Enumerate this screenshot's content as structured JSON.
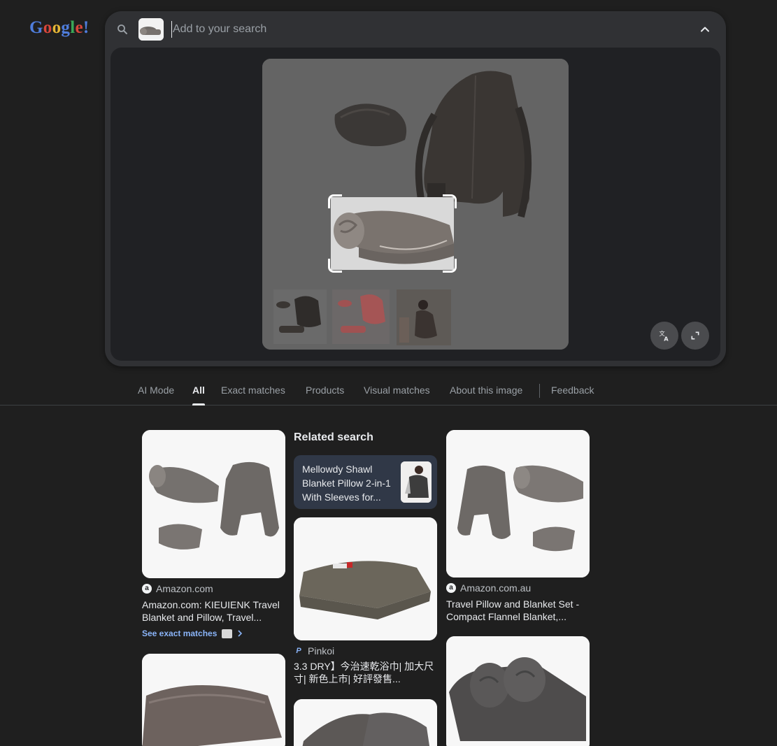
{
  "logo": {
    "letters": [
      "G",
      "o",
      "o",
      "g",
      "l",
      "e",
      "!"
    ]
  },
  "search": {
    "placeholder": "Add to your search"
  },
  "tabs": [
    {
      "label": "AI Mode"
    },
    {
      "label": "All"
    },
    {
      "label": "Exact matches"
    },
    {
      "label": "Products"
    },
    {
      "label": "Visual matches"
    },
    {
      "label": "About this image"
    },
    {
      "label": "Feedback"
    }
  ],
  "results": {
    "related_heading": "Related search",
    "related": {
      "text": "Mellowdy Shawl Blanket Pillow 2-in-1 With Sleeves for..."
    },
    "items": [
      {
        "source": "Amazon.com",
        "title": "Amazon.com: KIEUIENK Travel Blanket and Pillow, Travel...",
        "favicon": "a"
      },
      {
        "source": "Pinkoi",
        "title": "3.3 DRY】今治速乾浴巾| 加大尺寸| 新色上市| 好評發售...",
        "favicon": "P"
      },
      {
        "source": "Amazon.com.au",
        "title": "Travel Pillow and Blanket Set - Compact Flannel Blanket,...",
        "favicon": "a"
      }
    ],
    "exact_matches_link": "See exact matches"
  },
  "icons": {
    "search": "search-icon",
    "collapse": "chevron-up-icon",
    "translate": "translate-icon",
    "fullscreen": "fullscreen-icon"
  },
  "colors": {
    "background": "#1f1f1f",
    "panel": "#303134",
    "link": "#8ab4f8",
    "related_card": "#303847"
  }
}
